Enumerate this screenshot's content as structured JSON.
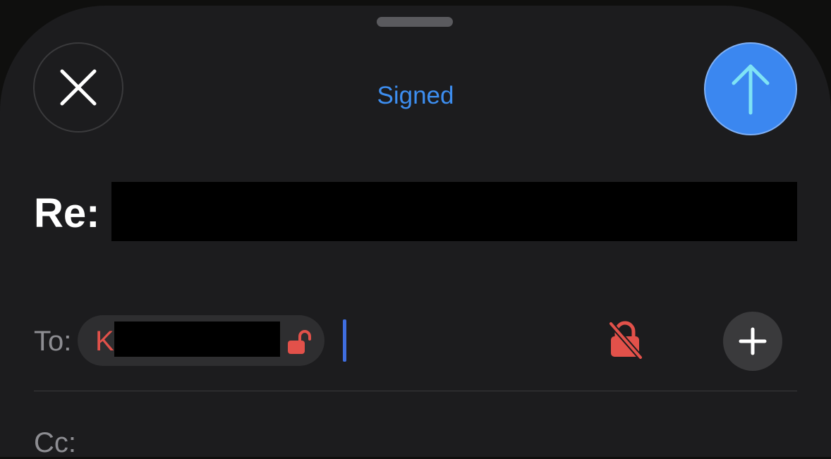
{
  "header": {
    "title": "Signed",
    "close_icon": "close-icon",
    "send_icon": "arrow-up-icon",
    "send_color": "#3b87f0",
    "title_color": "#3d8ef0"
  },
  "subject": {
    "prefix": "Re:",
    "value_redacted": true
  },
  "to": {
    "label": "To:",
    "recipient_initial": "K",
    "recipient_name_redacted": true,
    "recipient_status_icon": "unlocked-padlock-icon",
    "encryption_status_icon": "padlock-slash-icon",
    "status_color": "#e2514a",
    "add_icon": "plus-icon"
  },
  "cc": {
    "label": "Cc:"
  }
}
